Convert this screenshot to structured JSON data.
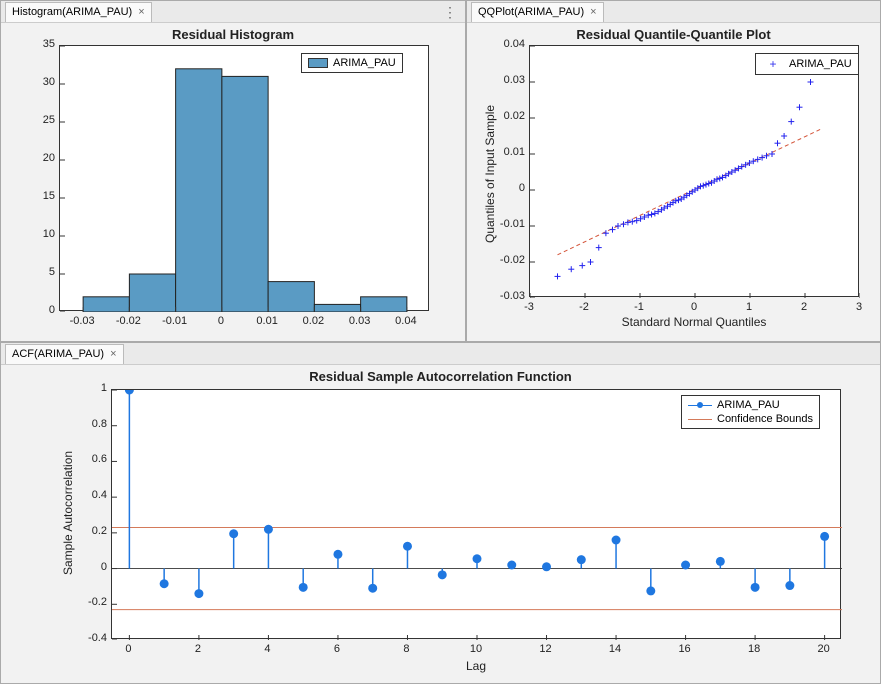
{
  "tabs": {
    "histogram": "Histogram(ARIMA_PAU)",
    "qqplot": "QQPlot(ARIMA_PAU)",
    "acf": "ACF(ARIMA_PAU)"
  },
  "legends": {
    "series": "ARIMA_PAU",
    "conf": "Confidence Bounds"
  },
  "chart_data": [
    {
      "id": "histogram",
      "type": "bar",
      "title": "Residual Histogram",
      "xlabel": "",
      "ylabel": "",
      "xlim": [
        -0.035,
        0.045
      ],
      "ylim": [
        0,
        35
      ],
      "xticks": [
        -0.03,
        -0.02,
        -0.01,
        0,
        0.01,
        0.02,
        0.03,
        0.04
      ],
      "yticks": [
        0,
        5,
        10,
        15,
        20,
        25,
        30,
        35
      ],
      "bin_edges": [
        -0.03,
        -0.02,
        -0.01,
        0,
        0.01,
        0.02,
        0.03,
        0.04
      ],
      "values": [
        2,
        5,
        32,
        31,
        4,
        1,
        2
      ],
      "series": [
        {
          "name": "ARIMA_PAU"
        }
      ],
      "color": "#5a9bc4"
    },
    {
      "id": "qqplot",
      "type": "scatter",
      "title": "Residual Quantile-Quantile Plot",
      "xlabel": "Standard Normal Quantiles",
      "ylabel": "Quantiles of Input Sample",
      "xlim": [
        -3,
        3
      ],
      "ylim": [
        -0.03,
        0.04
      ],
      "xticks": [
        -3,
        -2,
        -1,
        0,
        1,
        2,
        3
      ],
      "yticks": [
        -0.03,
        -0.02,
        -0.01,
        0,
        0.01,
        0.02,
        0.03,
        0.04
      ],
      "series": [
        {
          "name": "ARIMA_PAU"
        }
      ],
      "reference_line": {
        "x": [
          -2.5,
          2.3
        ],
        "y": [
          -0.018,
          0.017
        ]
      },
      "points": [
        [
          -2.5,
          -0.024
        ],
        [
          -2.25,
          -0.022
        ],
        [
          -2.05,
          -0.021
        ],
        [
          -1.9,
          -0.02
        ],
        [
          -1.75,
          -0.016
        ],
        [
          -1.62,
          -0.012
        ],
        [
          -1.5,
          -0.011
        ],
        [
          -1.4,
          -0.01
        ],
        [
          -1.3,
          -0.0095
        ],
        [
          -1.22,
          -0.009
        ],
        [
          -1.14,
          -0.0088
        ],
        [
          -1.06,
          -0.0085
        ],
        [
          -0.99,
          -0.008
        ],
        [
          -0.92,
          -0.0075
        ],
        [
          -0.85,
          -0.007
        ],
        [
          -0.79,
          -0.0068
        ],
        [
          -0.73,
          -0.0065
        ],
        [
          -0.67,
          -0.006
        ],
        [
          -0.61,
          -0.0055
        ],
        [
          -0.56,
          -0.005
        ],
        [
          -0.5,
          -0.0045
        ],
        [
          -0.45,
          -0.004
        ],
        [
          -0.4,
          -0.0035
        ],
        [
          -0.35,
          -0.003
        ],
        [
          -0.3,
          -0.0028
        ],
        [
          -0.25,
          -0.0025
        ],
        [
          -0.2,
          -0.002
        ],
        [
          -0.15,
          -0.0015
        ],
        [
          -0.1,
          -0.001
        ],
        [
          -0.05,
          -0.0005
        ],
        [
          0.0,
          0.0
        ],
        [
          0.05,
          0.0005
        ],
        [
          0.1,
          0.001
        ],
        [
          0.15,
          0.0012
        ],
        [
          0.2,
          0.0015
        ],
        [
          0.25,
          0.0018
        ],
        [
          0.3,
          0.002
        ],
        [
          0.35,
          0.0025
        ],
        [
          0.4,
          0.003
        ],
        [
          0.45,
          0.0032
        ],
        [
          0.5,
          0.0035
        ],
        [
          0.56,
          0.004
        ],
        [
          0.61,
          0.0045
        ],
        [
          0.67,
          0.005
        ],
        [
          0.73,
          0.0055
        ],
        [
          0.79,
          0.006
        ],
        [
          0.85,
          0.0065
        ],
        [
          0.92,
          0.007
        ],
        [
          0.99,
          0.0075
        ],
        [
          1.06,
          0.008
        ],
        [
          1.14,
          0.0085
        ],
        [
          1.22,
          0.009
        ],
        [
          1.3,
          0.0095
        ],
        [
          1.4,
          0.01
        ],
        [
          1.5,
          0.013
        ],
        [
          1.62,
          0.015
        ],
        [
          1.75,
          0.019
        ],
        [
          1.9,
          0.023
        ],
        [
          2.1,
          0.03
        ]
      ]
    },
    {
      "id": "acf",
      "type": "stem",
      "title": "Residual Sample Autocorrelation Function",
      "xlabel": "Lag",
      "ylabel": "Sample Autocorrelation",
      "xlim": [
        -0.5,
        20.5
      ],
      "ylim": [
        -0.4,
        1.0
      ],
      "xticks": [
        0,
        2,
        4,
        6,
        8,
        10,
        12,
        14,
        16,
        18,
        20
      ],
      "yticks": [
        -0.4,
        -0.2,
        0,
        0.2,
        0.4,
        0.6,
        0.8,
        1.0
      ],
      "confidence": 0.23,
      "series": [
        {
          "name": "ARIMA_PAU"
        },
        {
          "name": "Confidence Bounds"
        }
      ],
      "x": [
        0,
        1,
        2,
        3,
        4,
        5,
        6,
        7,
        8,
        9,
        10,
        11,
        12,
        13,
        14,
        15,
        16,
        17,
        18,
        19,
        20
      ],
      "y": [
        1.0,
        -0.085,
        -0.14,
        0.195,
        0.22,
        -0.105,
        0.08,
        -0.11,
        0.125,
        -0.035,
        0.055,
        0.02,
        0.01,
        0.05,
        0.16,
        -0.125,
        0.02,
        0.04,
        -0.105,
        -0.095,
        0.18
      ]
    }
  ]
}
